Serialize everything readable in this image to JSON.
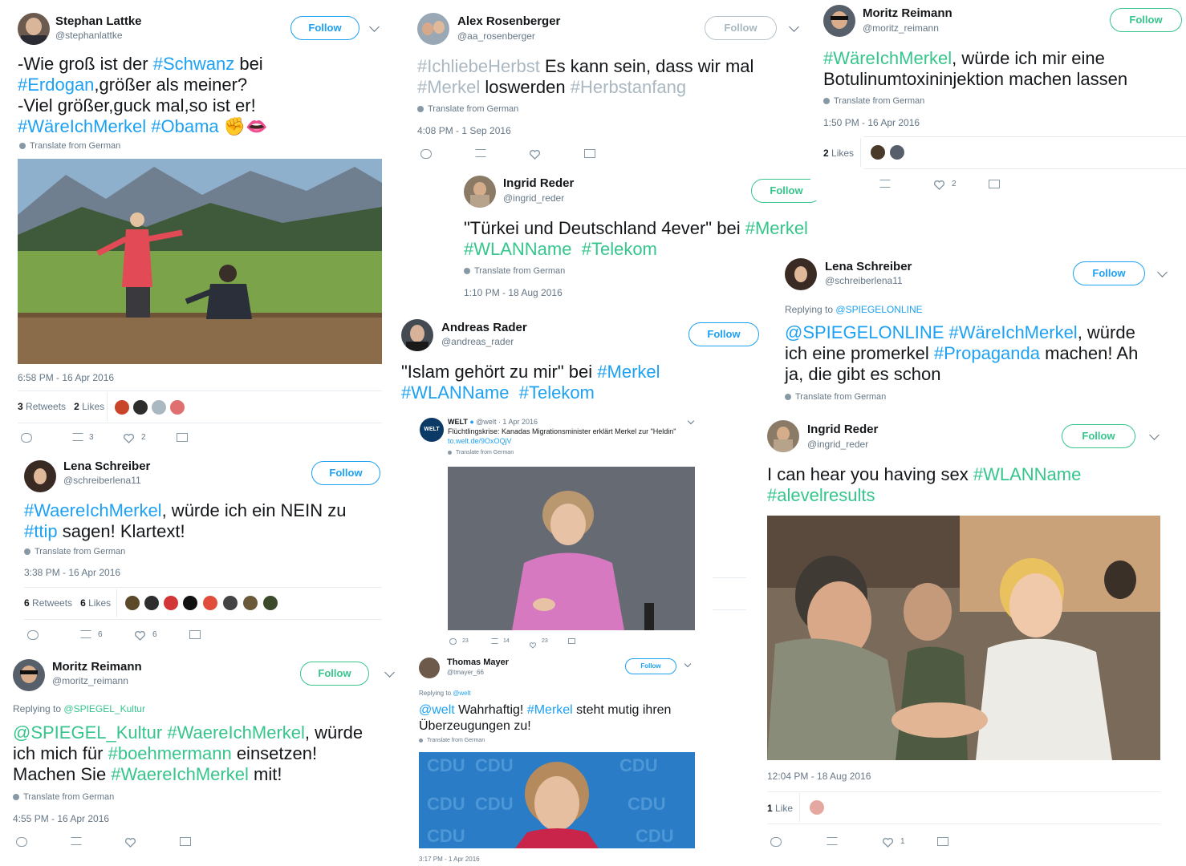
{
  "tweets": {
    "t1": {
      "name": "Stephan Lattke",
      "handle": "@stephanlattke",
      "follow": "Follow",
      "text_parts": [
        "-Wie groß ist der ",
        "#Schwanz",
        " bei ",
        "#Erdogan",
        ",größer als meiner?",
        "-Viel größer,guck mal,so ist er!",
        "#WäreIchMerkel",
        "#Obama"
      ],
      "emoji": "✊👄",
      "translate": "Translate from German",
      "time": "6:58 PM - 16 Apr 2016",
      "retweets": "3",
      "retweets_label": "Retweets",
      "likes": "2",
      "likes_label": "Likes",
      "rt_count": "3",
      "like_count": "2"
    },
    "t2": {
      "name": "Lena Schreiber",
      "handle": "@schreiberlena11",
      "follow": "Follow",
      "text_parts": [
        "#WaereIchMerkel",
        ", würde ich ein NEIN zu",
        "#ttip",
        " sagen! Klartext!"
      ],
      "translate": "Translate from German",
      "time": "3:38 PM - 16 Apr 2016",
      "retweets": "6",
      "retweets_label": "Retweets",
      "likes": "6",
      "likes_label": "Likes",
      "rt_count": "6",
      "like_count": "6"
    },
    "t3": {
      "name": "Moritz Reimann",
      "handle": "@moritz_reimann",
      "follow": "Follow",
      "replying": "Replying to",
      "replying_to": "@SPIEGEL_Kultur",
      "text_parts": [
        "@SPIEGEL_Kultur",
        "#WaereIchMerkel",
        ", würde",
        "ich mich für ",
        "#boehmermann",
        " einsetzen!",
        "Machen Sie ",
        "#WaereIchMerkel",
        " mit!"
      ],
      "translate": "Translate from German",
      "time": "4:55 PM - 16 Apr 2016"
    },
    "t4": {
      "name": "Alex Rosenberger",
      "handle": "@aa_rosenberger",
      "follow": "Follow",
      "text_parts": [
        "#IchliebeHerbst",
        " Es kann sein, dass wir mal",
        "#Merkel",
        " loswerden ",
        "#Herbstanfang"
      ],
      "translate": "Translate from German",
      "time": "4:08 PM - 1 Sep 2016"
    },
    "t5": {
      "name": "Ingrid Reder",
      "handle": "@ingrid_reder",
      "follow": "Follow",
      "text_parts": [
        "\"Türkei und Deutschland 4ever\" bei ",
        "#Merkel",
        "#WLANName",
        "#Telekom"
      ],
      "translate": "Translate from German",
      "time": "1:10 PM - 18 Aug 2016"
    },
    "t6": {
      "name": "Andreas Rader",
      "handle": "@andreas_rader",
      "follow": "Follow",
      "text_parts": [
        "\"Islam gehört zu mir\" bei ",
        "#Merkel",
        "#WLANName",
        "#Telekom"
      ],
      "embed": {
        "name": "WELT",
        "handle": "@welt · 1 Apr 2016",
        "logo": "WELT",
        "text": "Flüchtlingskrise: Kanadas Migrationsminister erklärt Merkel zur \"Heldin\"",
        "link": "to.welt.de/9OxOQjV",
        "translate": "Translate from German",
        "replies": "23",
        "retweets": "14",
        "likes": "23"
      },
      "reply": {
        "name": "Thomas Mayer",
        "handle": "@tmayer_66",
        "follow": "Follow",
        "replying": "Replying to",
        "replying_to": "@welt",
        "text_parts": [
          "@welt",
          " Wahrhaftig! ",
          "#Merkel",
          " steht mutig ihren",
          "Überzeugungen zu!"
        ],
        "translate": "Translate from German",
        "time": "3:17 PM - 1 Apr 2016"
      },
      "cdu": "CDU"
    },
    "t7": {
      "name": "Moritz Reimann",
      "handle": "@moritz_reimann",
      "follow": "Follow",
      "text_parts": [
        "#WäreIchMerkel",
        ", würde ich mir eine",
        "Botulinumtoxininjektion machen lassen"
      ],
      "translate": "Translate from German",
      "time": "1:50 PM - 16 Apr 2016",
      "likes": "2",
      "likes_label": "Likes",
      "like_count": "2"
    },
    "t8": {
      "name": "Lena Schreiber",
      "handle": "@schreiberlena11",
      "follow": "Follow",
      "replying": "Replying to",
      "replying_to": "@SPIEGELONLINE",
      "text_parts": [
        "@SPIEGELONLINE",
        "#WäreIchMerkel",
        ", würde",
        "ich eine promerkel ",
        "#Propaganda",
        " machen! Ah",
        "ja, die gibt es schon"
      ],
      "translate": "Translate from German"
    },
    "t9": {
      "name": "Ingrid Reder",
      "handle": "@ingrid_reder",
      "follow": "Follow",
      "text_parts": [
        "I can hear you having sex ",
        "#WLANName",
        "#alevelresults"
      ],
      "time": "12:04 PM - 18 Aug 2016",
      "likes": "1",
      "likes_label": "Like",
      "like_count": "1"
    }
  },
  "colors": {
    "twitter_blue": "#1da1f2",
    "green": "#36c58c",
    "gray": "#aab8c2"
  }
}
